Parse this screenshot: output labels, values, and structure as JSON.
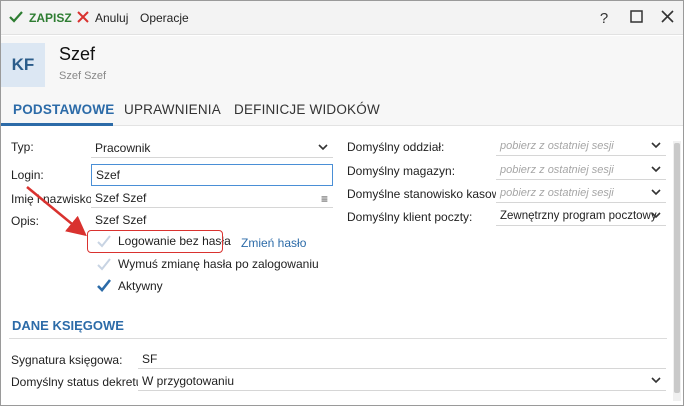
{
  "toolbar": {
    "save_label": "ZAPISZ",
    "cancel_label": "Anuluj",
    "operations_label": "Operacje",
    "help_label": "?"
  },
  "header": {
    "avatar_initials": "KF",
    "title": "Szef",
    "subtitle": "Szef Szef"
  },
  "tabs": [
    {
      "label": "PODSTAWOWE",
      "active": true
    },
    {
      "label": "UPRAWNIENIA",
      "active": false
    },
    {
      "label": "DEFINICJE WIDOKÓW",
      "active": false
    }
  ],
  "form": {
    "type_label": "Typ:",
    "type_value": "Pracownik",
    "login_label": "Login:",
    "login_value": "Szef",
    "fullname_label": "Imię i nazwisko:",
    "fullname_value": "Szef Szef",
    "desc_label": "Opis:",
    "desc_value": "Szef Szef",
    "login_without_password": {
      "label": "Logowanie bez hasła",
      "checked": false
    },
    "change_password_link": "Zmień hasło",
    "force_password_change": {
      "label": "Wymuś zmianę hasła po zalogowaniu",
      "checked": false
    },
    "active": {
      "label": "Aktywny",
      "checked": true
    }
  },
  "right_form": {
    "branch_label": "Domyślny oddział:",
    "branch_placeholder": "pobierz z ostatniej sesji",
    "warehouse_label": "Domyślny magazyn:",
    "warehouse_placeholder": "pobierz z ostatniej sesji",
    "pos_label": "Domyślne stanowisko kasowe:",
    "pos_placeholder": "pobierz z ostatniej sesji",
    "mail_client_label": "Domyślny klient poczty:",
    "mail_client_value": "Zewnętrzny program pocztowy"
  },
  "accounting": {
    "section_title": "DANE KSIĘGOWE",
    "signature_label": "Sygnatura księgowa:",
    "signature_value": "SF",
    "decree_status_label": "Domyślny status dekretu:",
    "decree_status_value": "W przygotowaniu"
  },
  "colors": {
    "accent": "#2c6ba8",
    "save_green": "#2e7d32",
    "cancel_red": "#d9322f",
    "highlight_red": "#d9322f"
  }
}
